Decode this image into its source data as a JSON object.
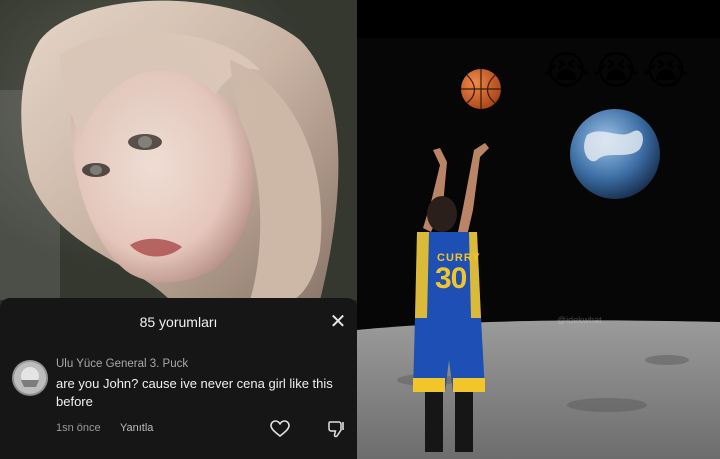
{
  "comments_sheet": {
    "title": "85 yorumları",
    "close_label": "✕"
  },
  "comment": {
    "username": "Ulu Yüce General 3. Puck",
    "text": "are you John? cause ive never cena girl like this before",
    "timestamp": "1sn önce",
    "reply_label": "Yanıtla"
  },
  "meme": {
    "emojis": [
      "😭",
      "😭",
      "😭"
    ],
    "jersey_name": "CURRY",
    "jersey_number": "30",
    "watermark": "@idekwhat"
  },
  "colors": {
    "sheet_bg": "#161616",
    "jersey_blue": "#1d4fb4",
    "jersey_gold": "#f2c52b"
  }
}
